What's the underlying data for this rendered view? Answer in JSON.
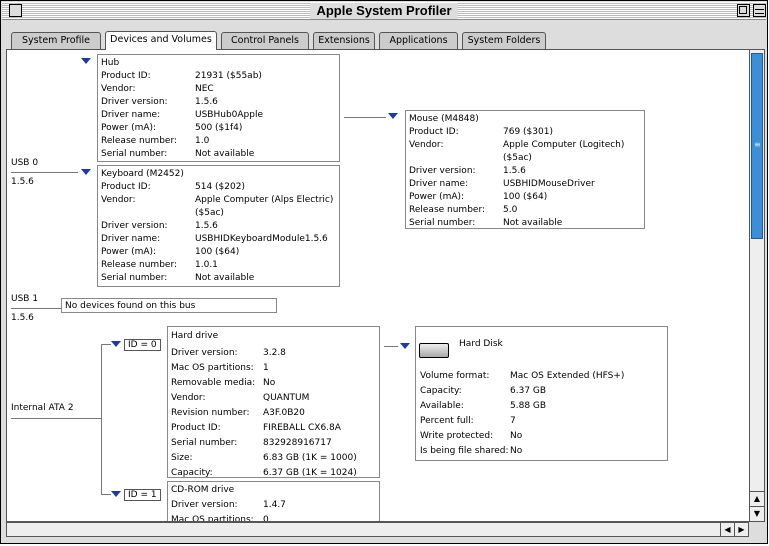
{
  "window": {
    "title": "Apple System Profiler"
  },
  "tabs": [
    "System Profile",
    "Devices and Volumes",
    "Control Panels",
    "Extensions",
    "Applications",
    "System Folders"
  ],
  "usb0": {
    "label": "USB 0",
    "version": "1.5.6"
  },
  "hub": {
    "title": "Hub",
    "rows": [
      [
        "Product ID:",
        "21931 ($55ab)"
      ],
      [
        "Vendor:",
        "NEC"
      ],
      [
        "Driver version:",
        "1.5.6"
      ],
      [
        "Driver name:",
        "USBHub0Apple"
      ],
      [
        "Power (mA):",
        "500 ($1f4)"
      ],
      [
        "Release number:",
        "1.0"
      ],
      [
        "Serial number:",
        "Not available"
      ]
    ]
  },
  "keyboard": {
    "title": "Keyboard (M2452)",
    "rows": [
      [
        "Product ID:",
        "514 ($202)"
      ],
      [
        "Vendor:",
        "Apple Computer (Alps Electric)",
        "($5ac)"
      ],
      [
        "Driver version:",
        "1.5.6"
      ],
      [
        "Driver name:",
        "USBHIDKeyboardModule1.5.6"
      ],
      [
        "Power (mA):",
        "100 ($64)"
      ],
      [
        "Release number:",
        "1.0.1"
      ],
      [
        "Serial number:",
        "Not available"
      ]
    ]
  },
  "mouse": {
    "title": "Mouse (M4848)",
    "rows": [
      [
        "Product ID:",
        "769 ($301)"
      ],
      [
        "Vendor:",
        "Apple Computer (Logitech)",
        "($5ac)"
      ],
      [
        "Driver version:",
        "1.5.6"
      ],
      [
        "Driver name:",
        "USBHIDMouseDriver"
      ],
      [
        "Power (mA):",
        "100 ($64)"
      ],
      [
        "Release number:",
        "5.0"
      ],
      [
        "Serial number:",
        "Not available"
      ]
    ]
  },
  "usb1": {
    "label": "USB 1",
    "version": "1.5.6",
    "message": "No devices found on this bus"
  },
  "ata": {
    "label": "Internal ATA 2"
  },
  "id0": "ID = 0",
  "id1": "ID = 1",
  "harddrive": {
    "title": "Hard drive",
    "rows": [
      [
        "Driver version:",
        "3.2.8"
      ],
      [
        "Mac OS partitions:",
        "1"
      ],
      [
        "Removable media:",
        "No"
      ],
      [
        "Vendor:",
        "QUANTUM"
      ],
      [
        "Revision number:",
        "A3F.0B20"
      ],
      [
        "Product ID:",
        "FIREBALL CX6.8A"
      ],
      [
        "Serial number:",
        "832928916717"
      ],
      [
        "Size:",
        "6.83 GB (1K = 1000)"
      ],
      [
        "Capacity:",
        "6.37 GB (1K = 1024)"
      ]
    ]
  },
  "harddisk": {
    "title": "Hard Disk",
    "rows": [
      [
        "Volume format:",
        "Mac OS Extended (HFS+)"
      ],
      [
        "Capacity:",
        "6.37 GB"
      ],
      [
        "Available:",
        "5.88 GB"
      ],
      [
        "Percent full:",
        "7"
      ],
      [
        "Write protected:",
        "No"
      ],
      [
        "Is being file shared:",
        "No"
      ]
    ]
  },
  "cdrom": {
    "title": "CD-ROM drive",
    "rows": [
      [
        "Driver version:",
        "1.4.7"
      ],
      [
        "Mac OS partitions:",
        "0"
      ]
    ]
  }
}
